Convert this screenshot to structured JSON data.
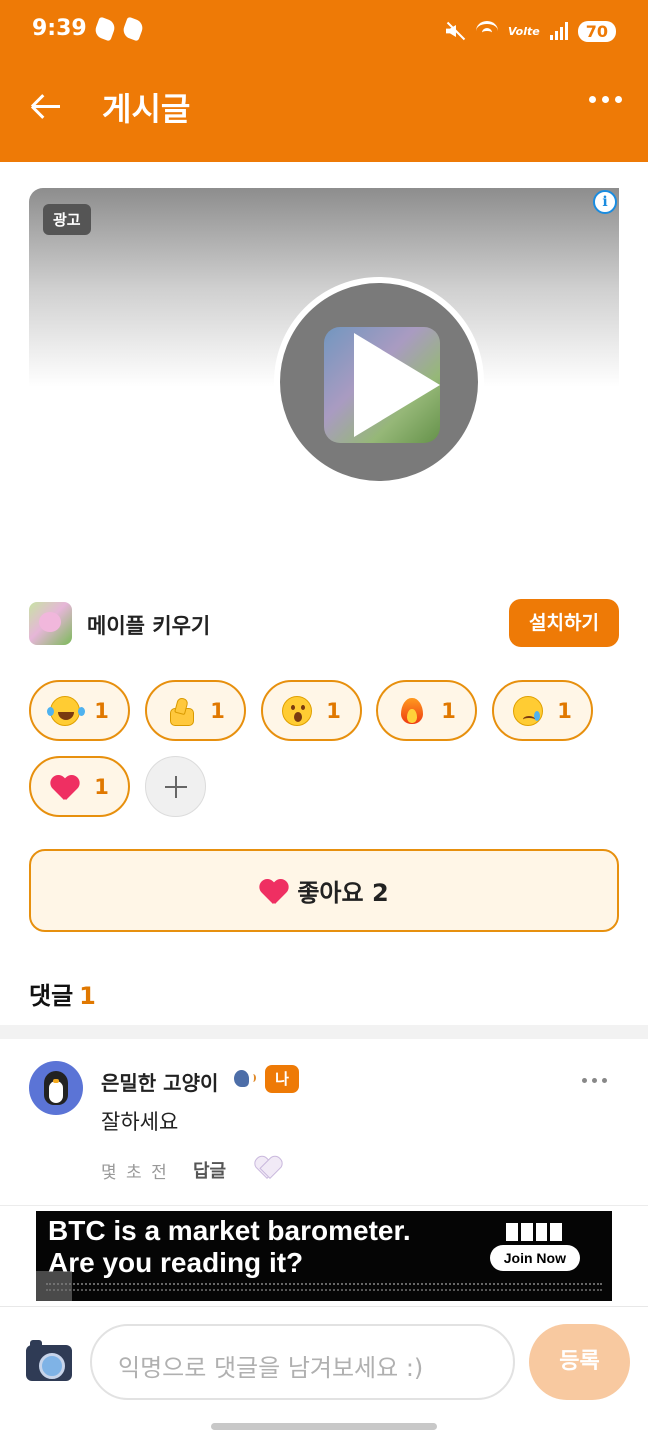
{
  "status_bar": {
    "time": "9:39",
    "battery": "70",
    "network": "Volte"
  },
  "header": {
    "title": "게시글"
  },
  "ad": {
    "badge": "광고",
    "app_name": "메이플 키우기",
    "install_label": "설치하기"
  },
  "reactions": [
    {
      "emoji": "laughing-crying",
      "count": "1"
    },
    {
      "emoji": "thumbs-up",
      "count": "1"
    },
    {
      "emoji": "surprised",
      "count": "1"
    },
    {
      "emoji": "fire",
      "count": "1"
    },
    {
      "emoji": "crying",
      "count": "1"
    },
    {
      "emoji": "heart",
      "count": "1"
    }
  ],
  "like": {
    "label": "좋아요 2"
  },
  "comments": {
    "heading": "댓글",
    "count": "1",
    "items": [
      {
        "author": "은밀한 고양이",
        "badge": "나",
        "text": "잘하세요",
        "time": "몇 초 전",
        "reply_label": "답글"
      }
    ]
  },
  "banner_ad": {
    "line1": "BTC is a market barometer.",
    "line2": "Are you reading it?",
    "cta": "Join Now"
  },
  "composer": {
    "placeholder": "익명으로 댓글을 남겨보세요 :)",
    "submit_label": "등록"
  },
  "colors": {
    "brand": "#ee7a06",
    "reaction_bg": "#fff6e7",
    "reaction_border": "#e7900e"
  }
}
